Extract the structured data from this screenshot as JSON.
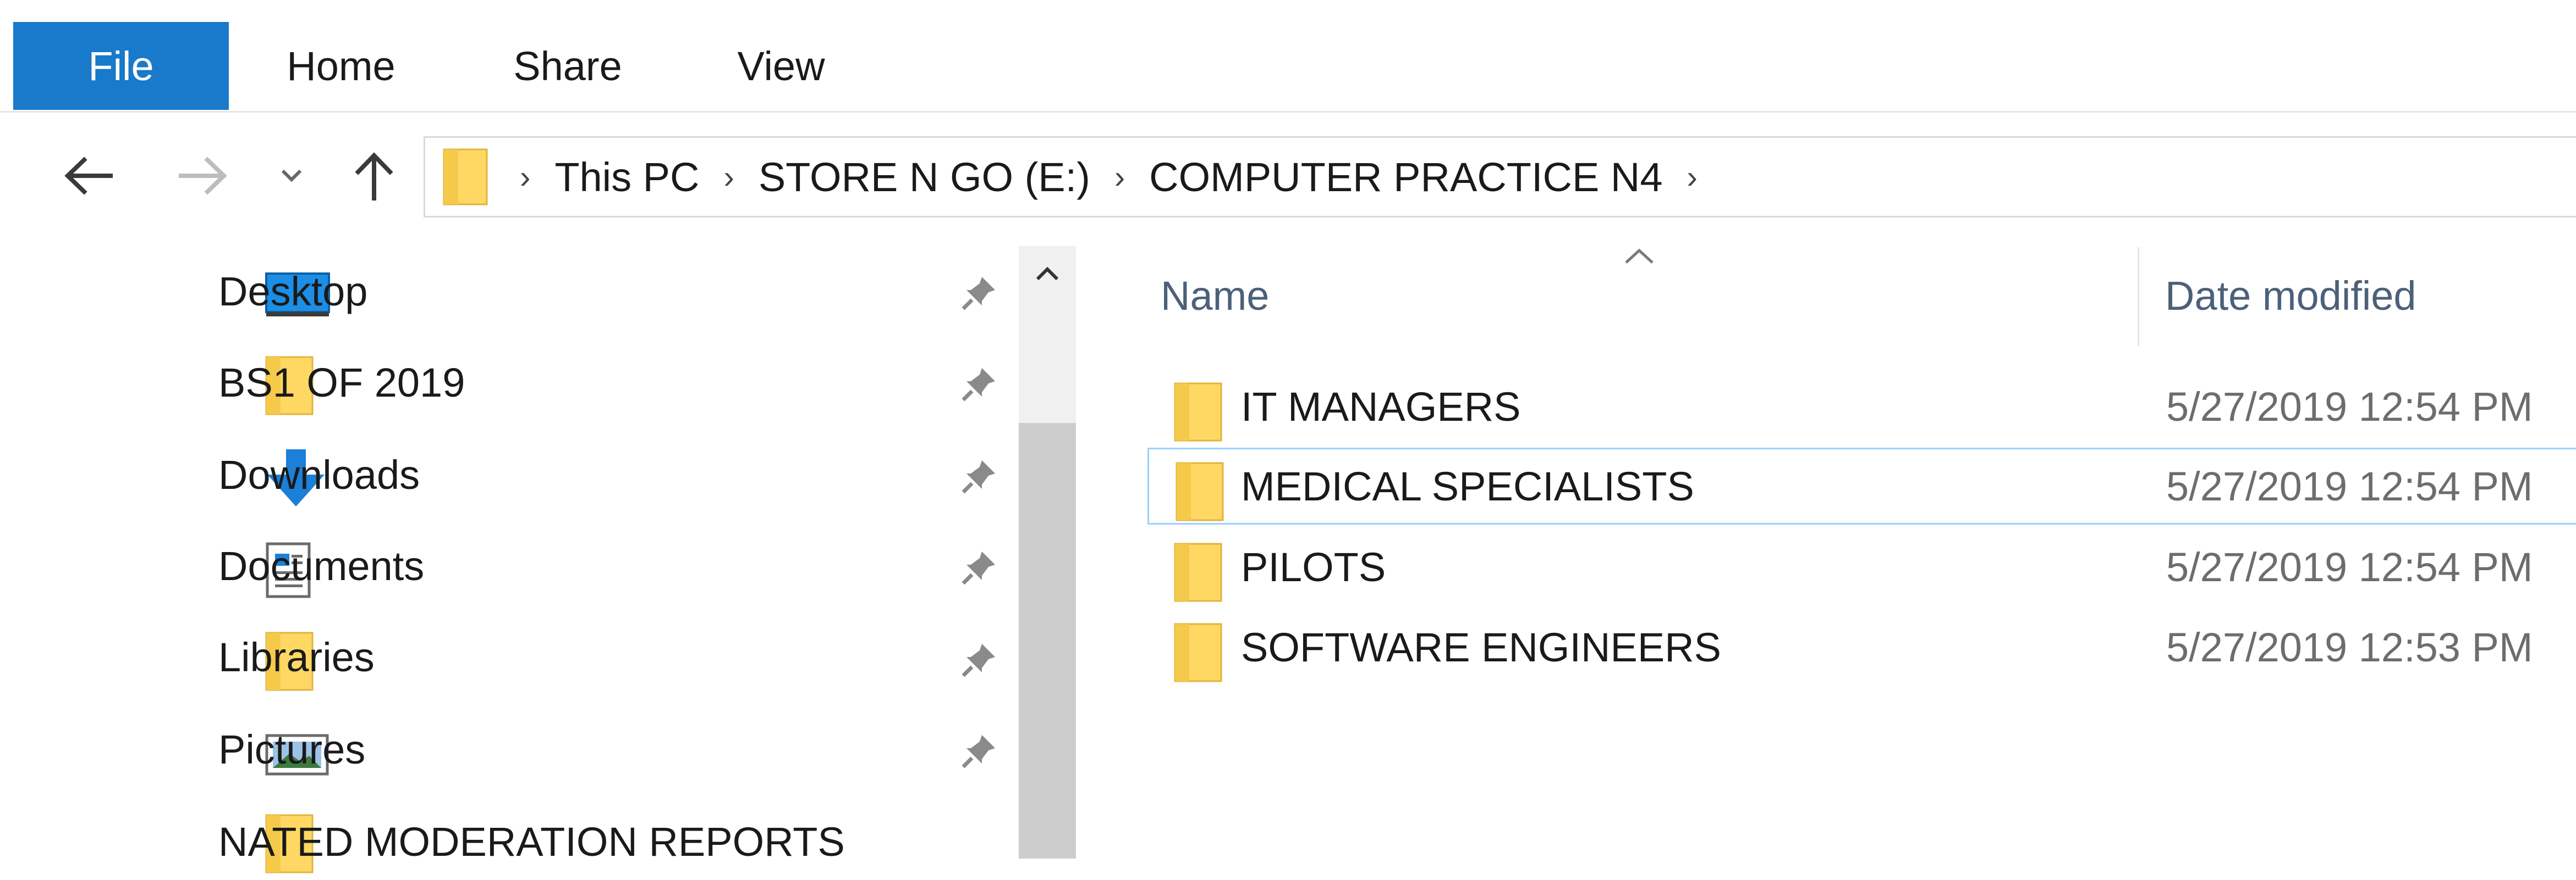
{
  "ribbon": {
    "tabs": [
      {
        "label": "File"
      },
      {
        "label": "Home"
      },
      {
        "label": "Share"
      },
      {
        "label": "View"
      }
    ]
  },
  "address": {
    "crumbs": [
      "This PC",
      "STORE N GO (E:)",
      "COMPUTER PRACTICE N4"
    ]
  },
  "sidebar": {
    "items": [
      {
        "label": "Desktop",
        "icon": "desktop-icon",
        "pinned": true
      },
      {
        "label": "BS1 OF 2019",
        "icon": "folder-icon",
        "pinned": true
      },
      {
        "label": "Downloads",
        "icon": "download-icon",
        "pinned": true
      },
      {
        "label": "Documents",
        "icon": "documents-icon",
        "pinned": true
      },
      {
        "label": "Libraries",
        "icon": "folder-icon",
        "pinned": true
      },
      {
        "label": "Pictures",
        "icon": "pictures-icon",
        "pinned": true
      },
      {
        "label": "NATED MODERATION REPORTS",
        "icon": "folder-icon",
        "pinned": false
      }
    ]
  },
  "file_list": {
    "columns": {
      "name": "Name",
      "date": "Date modified"
    },
    "sort_column": "Name",
    "rows": [
      {
        "name": "IT MANAGERS",
        "date": "5/27/2019 12:54 PM",
        "selected": false
      },
      {
        "name": "MEDICAL SPECIALISTS",
        "date": "5/27/2019 12:54 PM",
        "selected": true
      },
      {
        "name": "PILOTS",
        "date": "5/27/2019 12:54 PM",
        "selected": false
      },
      {
        "name": "SOFTWARE ENGINEERS",
        "date": "5/27/2019 12:53 PM",
        "selected": false
      }
    ]
  },
  "colors": {
    "accent": "#1979ca",
    "folder": "#ffd864",
    "selection_border": "#99d1ff",
    "header_text": "#4c607a",
    "date_text": "#6d6d6d"
  }
}
